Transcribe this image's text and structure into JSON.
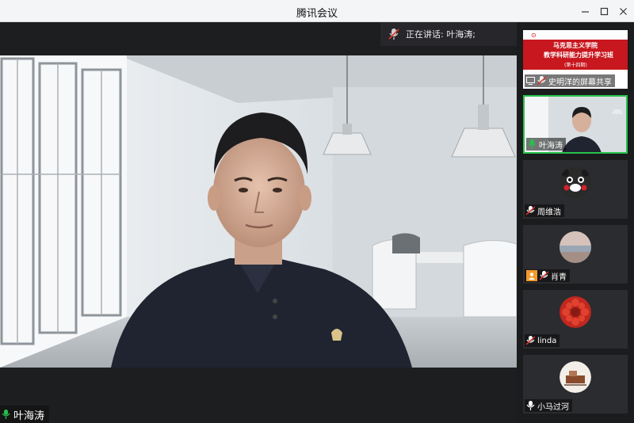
{
  "window": {
    "title": "腾讯会议",
    "controls": {
      "minimize": "—",
      "maximize": "☐",
      "close": "✕"
    }
  },
  "speaking": {
    "label": "正在讲话: 叶海涛;"
  },
  "main_video": {
    "participant": "叶海涛"
  },
  "screen_share": {
    "slide_line1": "马克思主义学院",
    "slide_line2": "教学科研能力提升学习班",
    "slide_line3": "(第十四期)",
    "label": "史明洋的屏幕共享"
  },
  "participants": [
    {
      "name": "叶海涛",
      "mic": "on"
    },
    {
      "name": "周维浩",
      "mic": "muted"
    },
    {
      "name": "肖青",
      "mic": "muted"
    },
    {
      "name": "linda",
      "mic": "muted"
    },
    {
      "name": "小马过河",
      "mic": "on"
    }
  ],
  "colors": {
    "accent_green": "#27c24c",
    "muted_red": "#e0352b",
    "brand_orange": "#f39a2b",
    "slide_red": "#c8171e"
  }
}
